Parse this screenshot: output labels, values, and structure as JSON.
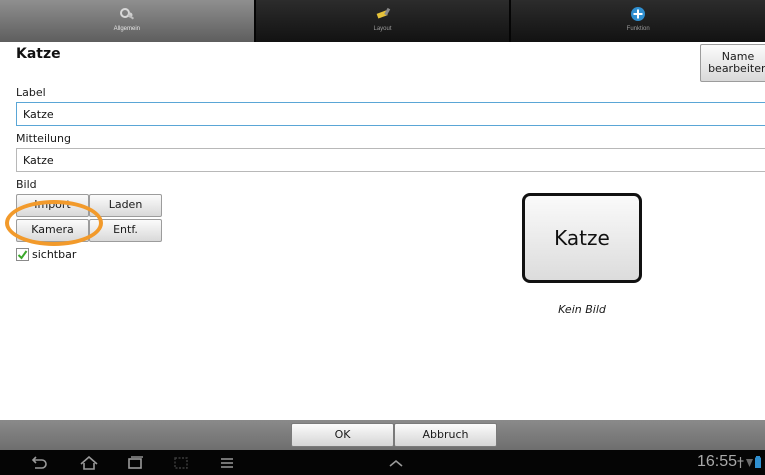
{
  "tabs": [
    {
      "label": "Allgemein",
      "icon": "wrench-icon",
      "active": true
    },
    {
      "label": "Layout",
      "icon": "paintbrush-icon",
      "active": false
    },
    {
      "label": "Funktion",
      "icon": "plus-circle-icon",
      "active": false
    }
  ],
  "form": {
    "title": "Katze",
    "name_button_label": "Name\nbearbeiten",
    "label_caption": "Label",
    "label_value": "Katze",
    "message_caption": "Mitteilung",
    "message_value": "Katze",
    "image_caption": "Bild",
    "buttons": {
      "import": "Import",
      "load": "Laden",
      "camera": "Kamera",
      "delete": "Entf."
    },
    "visible_label": "sichtbar",
    "visible_checked": true
  },
  "preview": {
    "tile_label": "Katze",
    "no_image_text": "Kein Bild"
  },
  "actions": {
    "ok": "OK",
    "cancel": "Abbruch"
  },
  "system": {
    "time": "16:55",
    "icons": [
      "back-icon",
      "home-icon",
      "recent-apps-icon",
      "screenshot-icon",
      "menu-icon",
      "chevron-up-icon",
      "usb-icon",
      "signal-icon",
      "battery-icon"
    ]
  },
  "colors": {
    "highlight_ring": "#f29a2b",
    "checkbox_check": "#3aa82a",
    "focus_border": "#5aa6d6"
  }
}
